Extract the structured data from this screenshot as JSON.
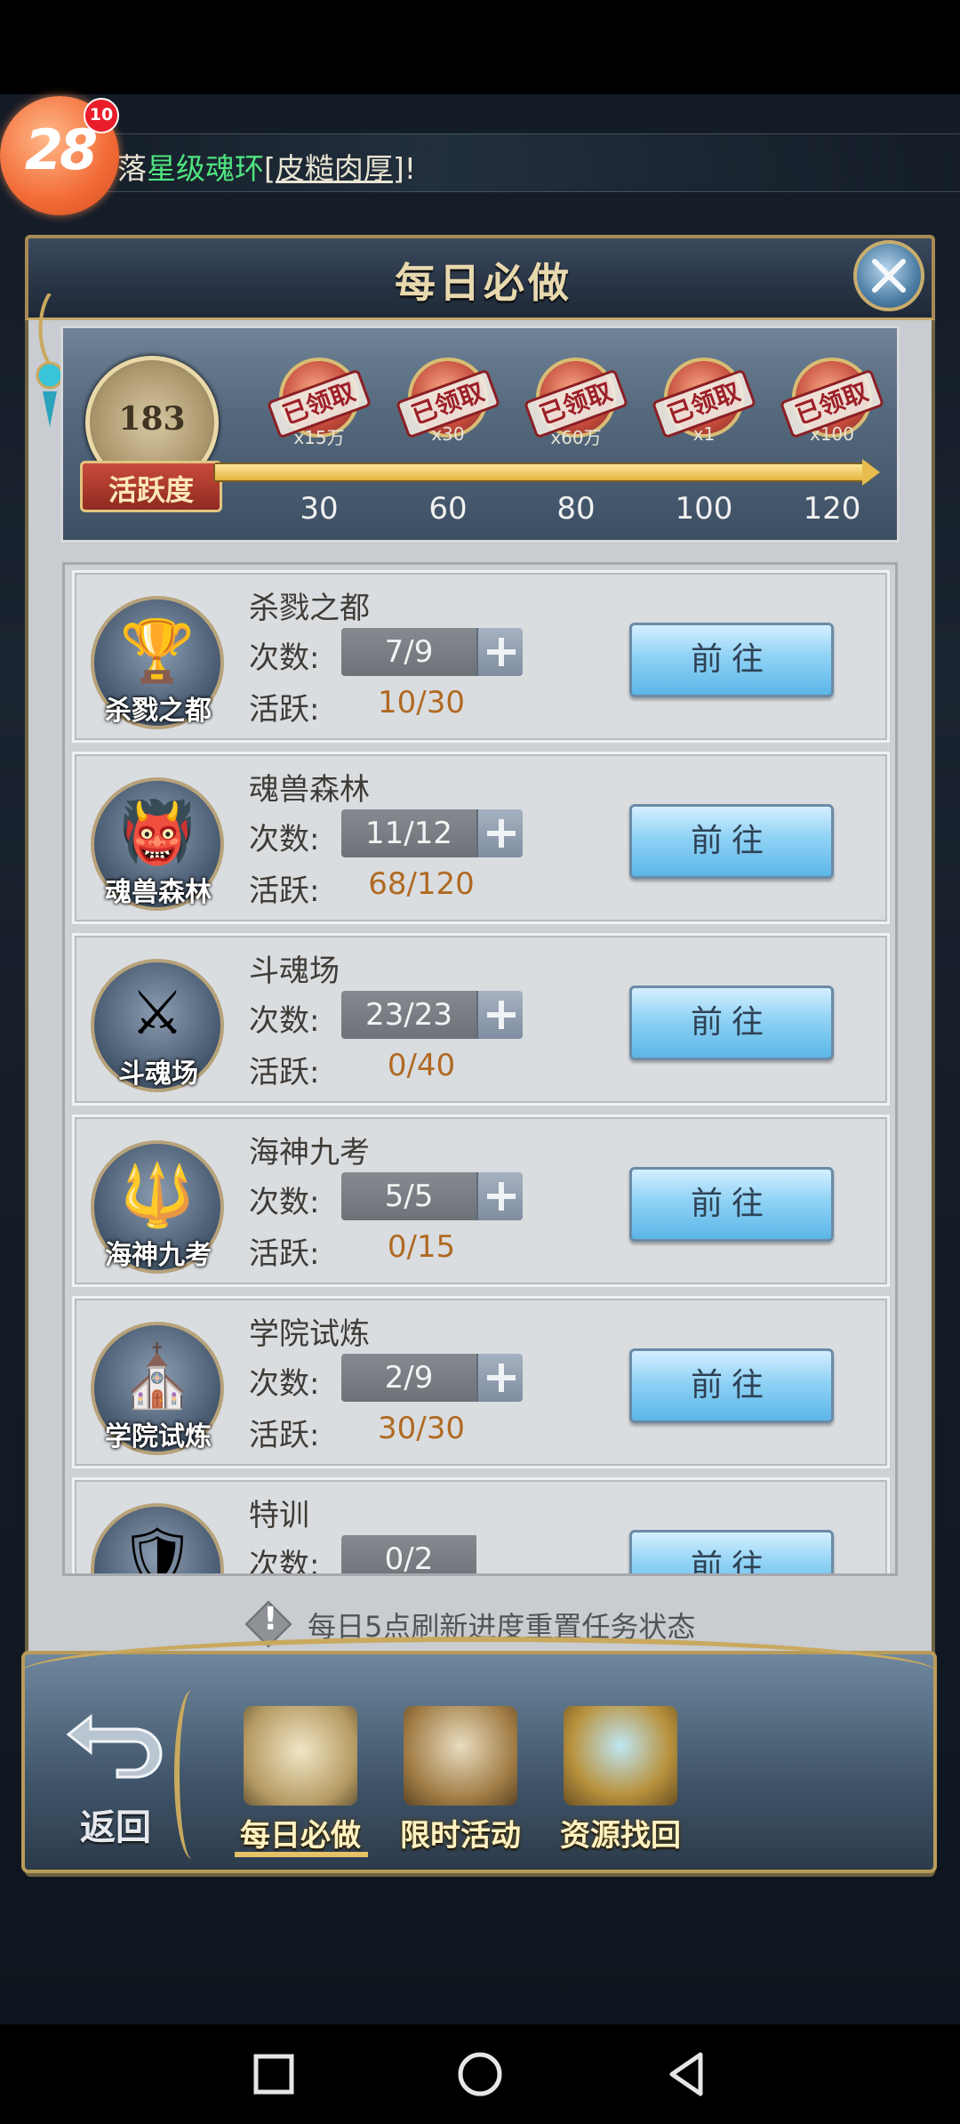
{
  "ticker": {
    "prefix": "落",
    "highlight": "星级魂环",
    "item": "[皮糙肉厚]",
    "suffix": "!"
  },
  "float_avatar": {
    "level": "28",
    "badge": "10"
  },
  "panel": {
    "title": "每日必做"
  },
  "activity": {
    "value": "183",
    "label": "活跃度",
    "progress": 1.0,
    "milestones": [
      {
        "threshold": "30",
        "reward_qty": "x15万",
        "status": "已领取"
      },
      {
        "threshold": "60",
        "reward_qty": "x30",
        "status": "已领取"
      },
      {
        "threshold": "80",
        "reward_qty": "x60万",
        "status": "已领取"
      },
      {
        "threshold": "100",
        "reward_qty": "x1",
        "status": "已领取"
      },
      {
        "threshold": "120",
        "reward_qty": "x100",
        "status": "已领取"
      }
    ]
  },
  "labels": {
    "count": "次数:",
    "active": "活跃:",
    "go": "前往"
  },
  "tasks": [
    {
      "name": "杀戮之都",
      "icon_label": "杀戮之都",
      "icon": "goblet-icon",
      "count": "7/9",
      "active": "10/30"
    },
    {
      "name": "魂兽森林",
      "icon_label": "魂兽森林",
      "icon": "beast-icon",
      "count": "11/12",
      "active": "68/120"
    },
    {
      "name": "斗魂场",
      "icon_label": "斗魂场",
      "icon": "arena-icon",
      "count": "23/23",
      "active": "0/40"
    },
    {
      "name": "海神九考",
      "icon_label": "海神九考",
      "icon": "trident-icon",
      "count": "5/5",
      "active": "0/15"
    },
    {
      "name": "学院试炼",
      "icon_label": "学院试炼",
      "icon": "academy-icon",
      "count": "2/9",
      "active": "30/30"
    },
    {
      "name": "特训",
      "icon_label": "",
      "icon": "training-icon",
      "count": "0/2",
      "active": ""
    }
  ],
  "hint": "每日5点刷新进度重置任务状态",
  "bottom": {
    "back_label": "返回",
    "tabs": [
      {
        "label": "每日必做",
        "icon": "scroll-quill-icon",
        "active": true
      },
      {
        "label": "限时活动",
        "icon": "clock-book-icon",
        "active": false
      },
      {
        "label": "资源找回",
        "icon": "treasure-chest-icon",
        "active": false
      }
    ]
  },
  "colors": {
    "accent_gold": "#c9a95f",
    "go_button": "#8fd2f5",
    "active_value": "#b06a22",
    "ticker_highlight": "#4fe37f"
  }
}
